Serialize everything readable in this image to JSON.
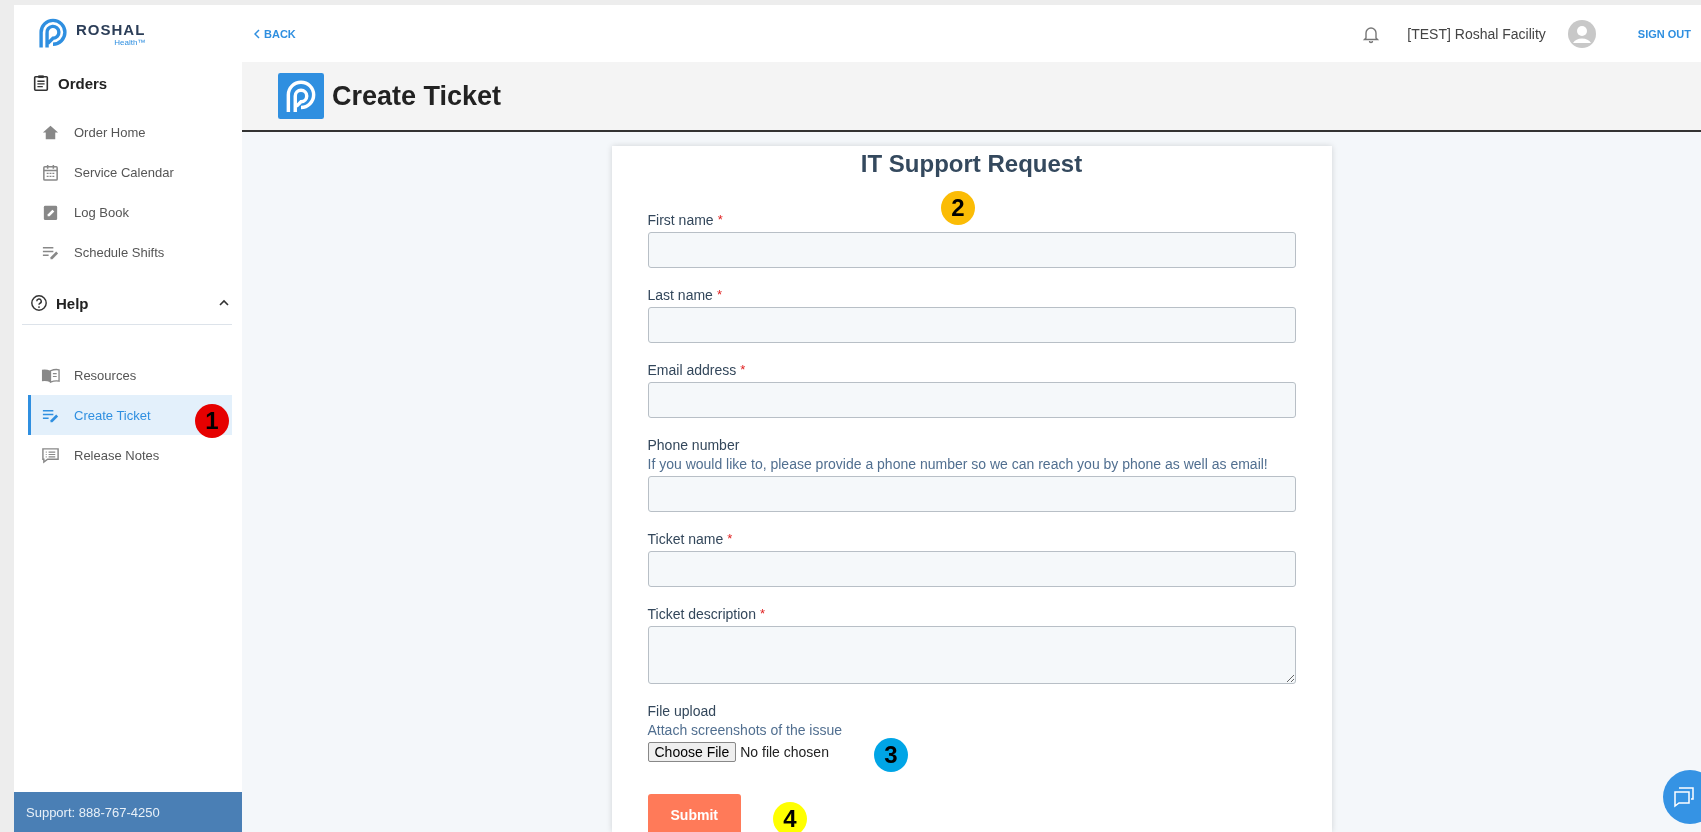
{
  "brand": {
    "name": "ROSHAL",
    "sub": "Health™"
  },
  "sidebar": {
    "sections": [
      {
        "title": "Orders",
        "items": [
          {
            "label": "Order Home",
            "selected": false
          },
          {
            "label": "Service Calendar",
            "selected": false
          },
          {
            "label": "Log Book",
            "selected": false
          },
          {
            "label": "Schedule Shifts",
            "selected": false
          }
        ]
      },
      {
        "title": "Help",
        "expanded": true,
        "items": [
          {
            "label": "Resources",
            "selected": false
          },
          {
            "label": "Create Ticket",
            "selected": true
          },
          {
            "label": "Release Notes",
            "selected": false
          }
        ]
      }
    ],
    "support": "Support: 888-767-4250"
  },
  "header": {
    "back": "BACK",
    "user": "[TEST] Roshal Facility",
    "sign_out": "SIGN OUT"
  },
  "page_title": "Create Ticket",
  "form": {
    "title": "IT Support Request",
    "fields": [
      {
        "kind": "text",
        "label": "First name",
        "required_mark": "*"
      },
      {
        "kind": "text",
        "label": "Last name",
        "required_mark": "*"
      },
      {
        "kind": "text",
        "label": "Email address",
        "required_mark": "*"
      },
      {
        "kind": "text",
        "label": "Phone number",
        "hint": "If you would like to, please provide a phone number so we can reach you by phone as well as email!"
      },
      {
        "kind": "text",
        "label": "Ticket name",
        "required_mark": "*"
      },
      {
        "kind": "textarea",
        "label": "Ticket description",
        "required_mark": "*"
      },
      {
        "kind": "file",
        "label": "File upload",
        "hint": "Attach screenshots of the issue",
        "button": "Choose File",
        "status": "No file chosen"
      }
    ],
    "submit": "Submit"
  },
  "annotations": [
    {
      "label": "1",
      "color": "#e60000"
    },
    {
      "label": "2",
      "color": "#fbbc05"
    },
    {
      "label": "3",
      "color": "#00a5e6"
    },
    {
      "label": "4",
      "color": "#ffff00"
    }
  ]
}
